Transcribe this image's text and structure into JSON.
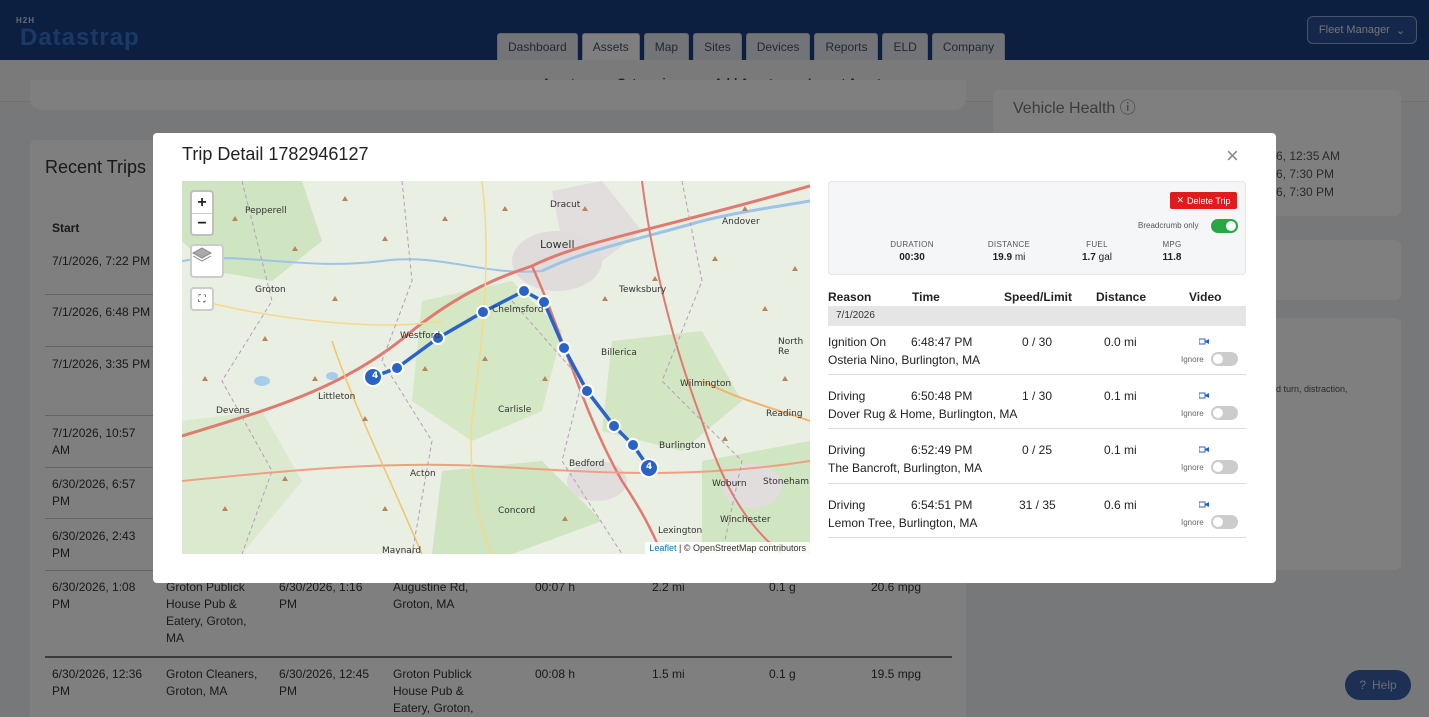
{
  "app": {
    "logo_small": "H2H",
    "logo_main": "Datastrap",
    "account_menu": "Fleet Manager"
  },
  "nav": {
    "tabs": [
      "Dashboard",
      "Assets",
      "Map",
      "Sites",
      "Devices",
      "Reports",
      "ELD",
      "Company"
    ],
    "active": "Assets"
  },
  "subnav": {
    "tabs": [
      "Assets",
      "Categories",
      "Add Asset",
      "Import Assets"
    ],
    "active": "Assets"
  },
  "background": {
    "recent_trips_title": "Recent Trips",
    "start_header": "Start",
    "starts": [
      "7/1/2026, 7:22 PM",
      "7/1/2026, 6:48 PM",
      "7/1/2026, 3:35 PM",
      "7/1/2026, 10:57 AM",
      "6/30/2026, 6:57 PM",
      "6/30/2026, 2:43 PM",
      "6/30/2026, 1:08 PM",
      "6/30/2026, 12:36 PM"
    ],
    "row7": {
      "from": "Groton Publick House Pub & Eatery, Groton, MA",
      "end": "6/30/2026, 1:16 PM",
      "to": "Augustine Rd, Groton, MA",
      "duration": "00:07 h",
      "distance": "2.2 mi",
      "fuel": "0.1 g",
      "mpg": "20.6 mpg"
    },
    "row8": {
      "from": "Groton Cleaners, Groton, MA",
      "end": "6/30/2026, 12:45 PM",
      "to": "Groton Publick House Pub & Eatery, Groton,",
      "duration": "00:08 h",
      "distance": "1.5 mi",
      "fuel": "0.1 g",
      "mpg": "19.5 mpg"
    },
    "vehicle_health_title": "Vehicle Health",
    "right_times": [
      "6, 12:35 AM",
      "6, 7:30 PM",
      "6, 7:30 PM"
    ],
    "right_snippet": "d turn, distraction,",
    "help": "Help"
  },
  "modal": {
    "title": "Trip Detail 1782946127",
    "delete_label": "Delete Trip",
    "breadcrumb_label": "Breadcrumb only",
    "breadcrumb_on": true,
    "stats": {
      "duration": {
        "label": "DURATION",
        "value": "00:30",
        "unit": ""
      },
      "distance": {
        "label": "DISTANCE",
        "value": "19.9",
        "unit": "mi"
      },
      "fuel": {
        "label": "FUEL",
        "value": "1.7",
        "unit": "gal"
      },
      "mpg": {
        "label": "MPG",
        "value": "11.8",
        "unit": ""
      }
    },
    "table_headers": {
      "reason": "Reason",
      "time": "Time",
      "speed": "Speed/Limit",
      "distance": "Distance",
      "video": "Video"
    },
    "date": "7/1/2026",
    "ignore_label": "Ignore",
    "events": [
      {
        "reason": "Ignition On",
        "time": "6:48:47 PM",
        "speed": "0 / 30",
        "distance": "0.0 mi",
        "location": "Osteria Nino, Burlington, MA"
      },
      {
        "reason": "Driving",
        "time": "6:50:48 PM",
        "speed": "1 / 30",
        "distance": "0.1 mi",
        "location": "Dover Rug & Home, Burlington, MA"
      },
      {
        "reason": "Driving",
        "time": "6:52:49 PM",
        "speed": "0 / 25",
        "distance": "0.1 mi",
        "location": "The Bancroft, Burlington, MA"
      },
      {
        "reason": "Driving",
        "time": "6:54:51 PM",
        "speed": "31 / 35",
        "distance": "0.6 mi",
        "location": "Lemon Tree, Burlington, MA"
      }
    ],
    "map": {
      "zoom_in": "+",
      "zoom_out": "−",
      "attribution_leaflet": "Leaflet",
      "attribution_rest": "| © OpenStreetMap contributors",
      "cluster_count_start": "4",
      "cluster_count_end": "4",
      "places": [
        "Dracut",
        "Lowell",
        "Pepperell",
        "Andover",
        "Tewksbury",
        "Groton",
        "Westford",
        "Chelmsford",
        "Billerica",
        "North Re",
        "Wilmington",
        "Littleton",
        "Devens",
        "Carlisle",
        "Reading",
        "Burlington",
        "Bedford",
        "Acton",
        "Woburn",
        "Stoneham",
        "Concord",
        "Winchester",
        "Lexington",
        "Maynard"
      ],
      "route_color": "#2a63c8"
    }
  }
}
